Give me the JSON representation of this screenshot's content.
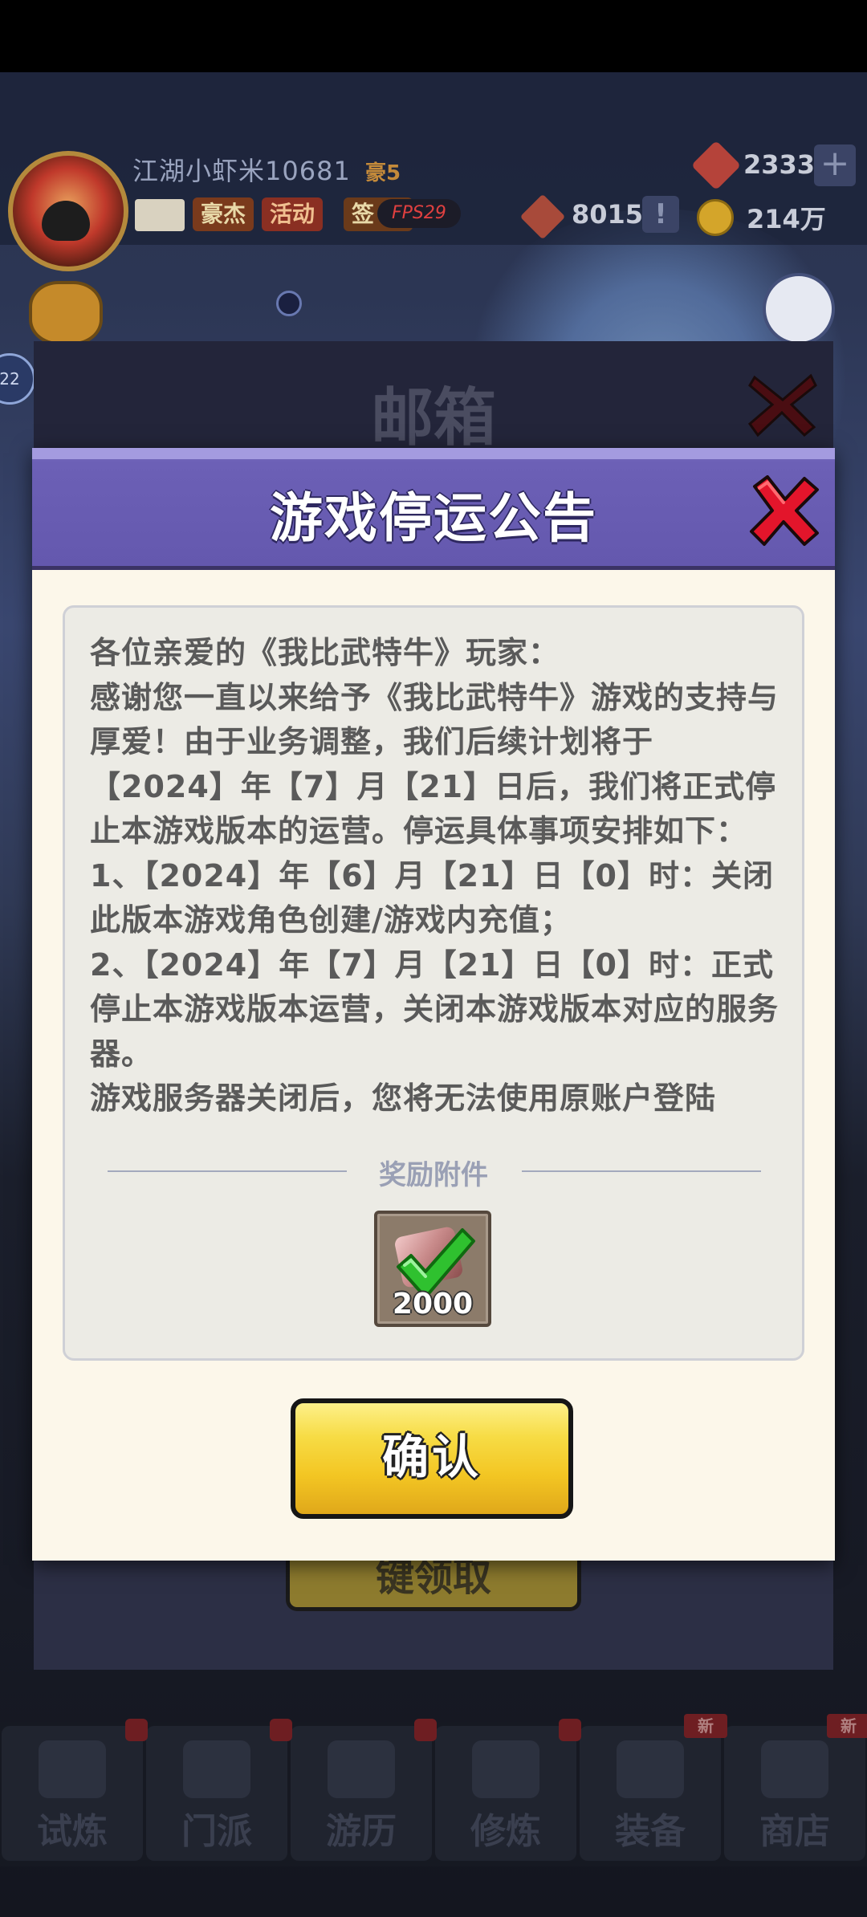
{
  "hud": {
    "player_name": "江湖小虾米10681",
    "rank": "豪5",
    "chips": {
      "haojie": "豪杰",
      "huodong": "活动",
      "qian": "签"
    },
    "fps": "FPS29",
    "gems": "2333",
    "plus": "+",
    "tokens": "8015",
    "alert": "!",
    "coins": "214万",
    "left_badge": "22"
  },
  "mailbox": {
    "title": "邮箱",
    "button_label": "键领取"
  },
  "modal": {
    "title": "游戏停运公告",
    "notice_lines": [
      "各位亲爱的《我比武特牛》玩家：",
      "感谢您一直以来给予《我比武特牛》游戏的支持与厚爱！由于业务调整，我们后续计划将于【2024】年【7】月【21】日后，我们将正式停止本游戏版本的运营。停运具体事项安排如下：",
      "1、【2024】年【6】月【21】日【0】时：关闭此版本游戏角色创建/游戏内充值；",
      "2、【2024】年【7】月【21】日【0】时：正式停止本游戏版本运营，关闭本游戏版本对应的服务器。",
      "游戏服务器关闭后，您将无法使用原账户登陆"
    ],
    "reward_label": "奖励附件",
    "reward_count": "2000",
    "confirm_label": "确认"
  },
  "nav": {
    "tabs": [
      "试炼",
      "门派",
      "游历",
      "修炼",
      "装备",
      "商店"
    ],
    "new_badge": "新"
  },
  "colors": {
    "modal_header": "#6c60b6",
    "confirm_button": "#f3c623",
    "close_x": "#e3152b",
    "check": "#2fc12f"
  }
}
